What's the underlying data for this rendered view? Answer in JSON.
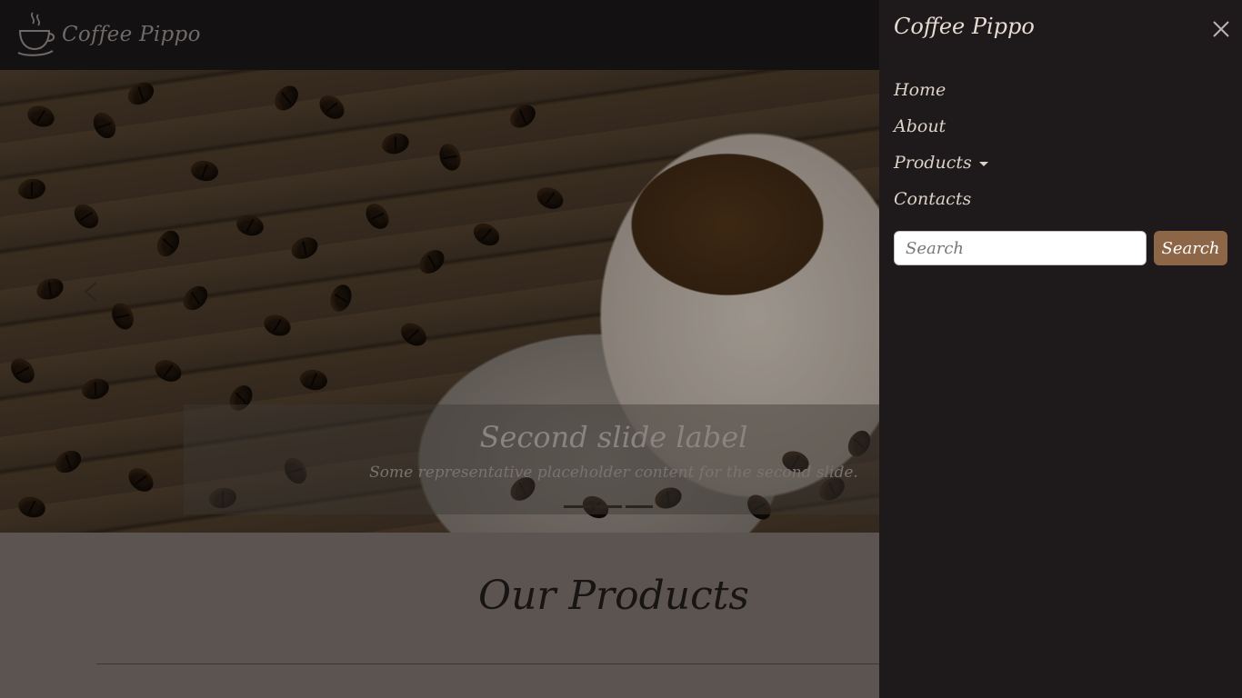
{
  "brand": {
    "name": "Coffee Pippo",
    "logo_icon": "coffee-cup-icon"
  },
  "hero": {
    "slide_title": "Second slide label",
    "slide_text": "Some representative placeholder content for the second slide.",
    "indicator_count": 3,
    "active_indicator": 2
  },
  "products": {
    "title": "Our Products"
  },
  "offcanvas": {
    "title": "Coffee Pippo",
    "close_icon": "close-icon",
    "nav": [
      {
        "label": "Home"
      },
      {
        "label": "About"
      },
      {
        "label": "Products",
        "dropdown": true
      },
      {
        "label": "Contacts"
      }
    ],
    "search": {
      "placeholder": "Search",
      "value": "",
      "button_label": "Search"
    }
  },
  "colors": {
    "navbar_bg": "#141113",
    "offcanvas_bg": "#1e1a1c",
    "accent_button": "#8c6647",
    "page_bg": "#5c5450"
  }
}
